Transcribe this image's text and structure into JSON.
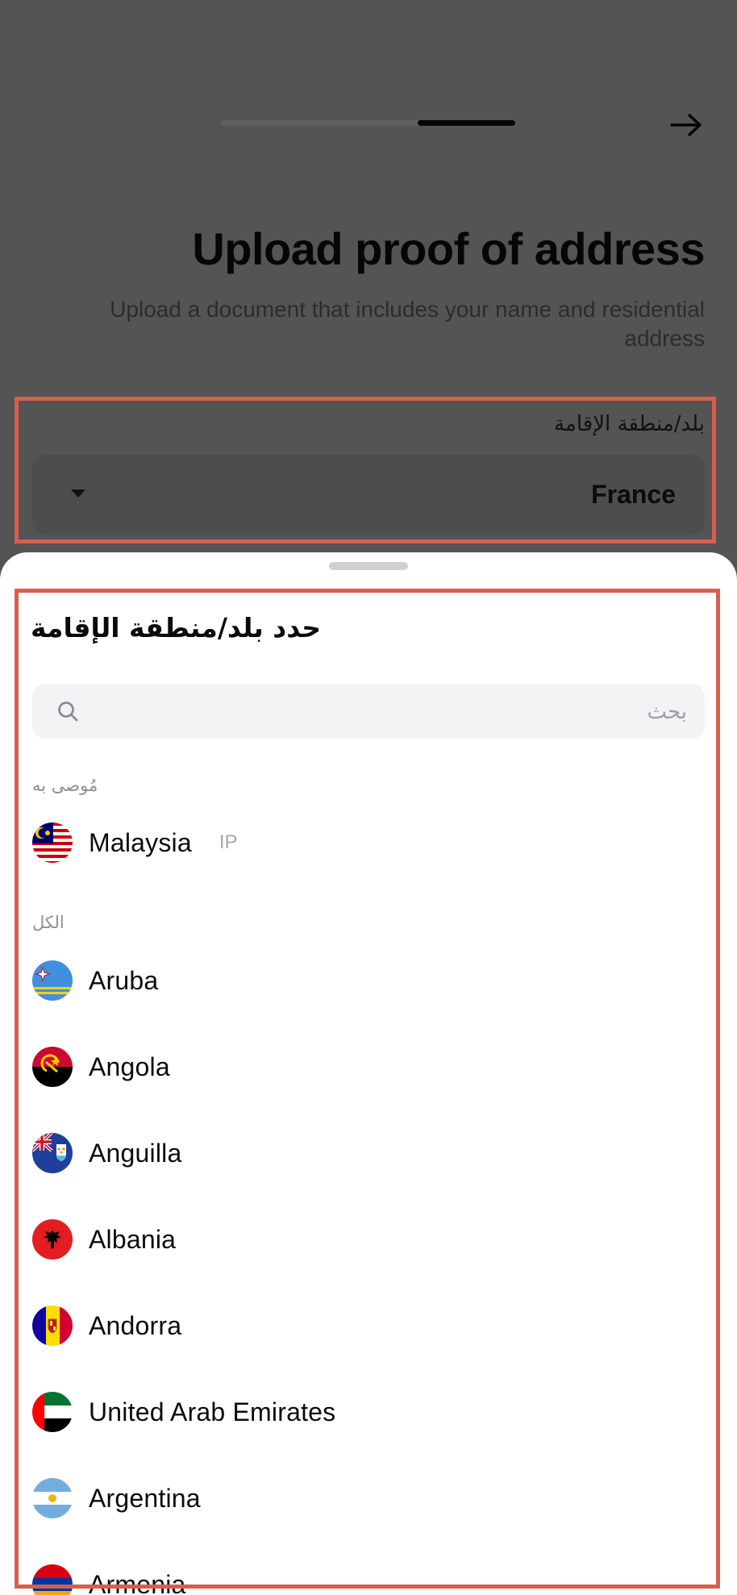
{
  "header": {
    "progress_fraction": 0.33,
    "back_icon": "arrow-right-icon"
  },
  "page": {
    "title": "Upload proof of address",
    "subtitle": "Upload a document that includes your name and residential address"
  },
  "country_field": {
    "label": "بلد/منطقة الإقامة",
    "value": "France"
  },
  "sheet": {
    "title": "حدد بلد/منطقة الإقامة",
    "search_placeholder": "بحث",
    "recommended_header": "مُوصى به",
    "all_header": "الكل",
    "recommended": [
      {
        "name": "Malaysia",
        "tag": "IP",
        "flag": "malaysia-flag-icon"
      }
    ],
    "countries": [
      {
        "name": "Aruba",
        "flag": "aruba-flag-icon"
      },
      {
        "name": "Angola",
        "flag": "angola-flag-icon"
      },
      {
        "name": "Anguilla",
        "flag": "anguilla-flag-icon"
      },
      {
        "name": "Albania",
        "flag": "albania-flag-icon"
      },
      {
        "name": "Andorra",
        "flag": "andorra-flag-icon"
      },
      {
        "name": "United Arab Emirates",
        "flag": "uae-flag-icon"
      },
      {
        "name": "Argentina",
        "flag": "argentina-flag-icon"
      },
      {
        "name": "Armenia",
        "flag": "armenia-flag-icon"
      }
    ]
  },
  "colors": {
    "overlay": "#545454",
    "highlight": "#d65f4d",
    "sheet_background": "#ffffff",
    "search_background": "#f1f3f4"
  }
}
